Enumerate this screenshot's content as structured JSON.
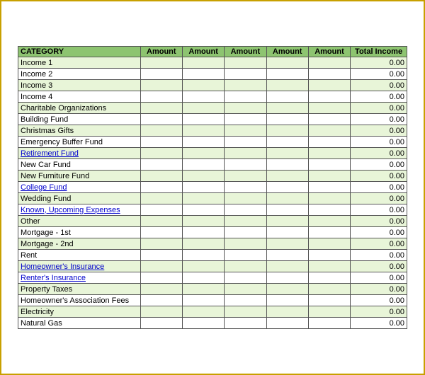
{
  "table": {
    "headers": {
      "category": "CATEGORY",
      "col1": "Amount",
      "col2": "Amount",
      "col3": "Amount",
      "col4": "Amount",
      "col5": "Amount",
      "total": "Total Income"
    },
    "rows": [
      {
        "label": "Income 1",
        "link": false,
        "total": "0.00",
        "shaded": true
      },
      {
        "label": "Income 2",
        "link": false,
        "total": "0.00",
        "shaded": false
      },
      {
        "label": "Income 3",
        "link": false,
        "total": "0.00",
        "shaded": true
      },
      {
        "label": "Income 4",
        "link": false,
        "total": "0.00",
        "shaded": false
      },
      {
        "label": "Charitable Organizations",
        "link": false,
        "total": "0.00",
        "shaded": true
      },
      {
        "label": "Building Fund",
        "link": false,
        "total": "0.00",
        "shaded": false
      },
      {
        "label": "Christmas Gifts",
        "link": false,
        "total": "0.00",
        "shaded": true
      },
      {
        "label": "Emergency Buffer Fund",
        "link": false,
        "total": "0.00",
        "shaded": false
      },
      {
        "label": "Retirement Fund",
        "link": true,
        "total": "0.00",
        "shaded": true
      },
      {
        "label": "New Car Fund",
        "link": false,
        "total": "0.00",
        "shaded": false
      },
      {
        "label": "New Furniture Fund",
        "link": false,
        "total": "0.00",
        "shaded": true
      },
      {
        "label": "College Fund",
        "link": true,
        "total": "0.00",
        "shaded": false
      },
      {
        "label": "Wedding Fund",
        "link": false,
        "total": "0.00",
        "shaded": true
      },
      {
        "label": "Known, Upcoming Expenses",
        "link": true,
        "total": "0.00",
        "shaded": false
      },
      {
        "label": "Other",
        "link": false,
        "total": "0.00",
        "shaded": true
      },
      {
        "label": "Mortgage - 1st",
        "link": false,
        "total": "0.00",
        "shaded": false
      },
      {
        "label": "Mortgage - 2nd",
        "link": false,
        "total": "0.00",
        "shaded": true
      },
      {
        "label": "Rent",
        "link": false,
        "total": "0.00",
        "shaded": false
      },
      {
        "label": "Homeowner's Insurance",
        "link": true,
        "total": "0.00",
        "shaded": true
      },
      {
        "label": "Renter's Insurance",
        "link": true,
        "total": "0.00",
        "shaded": false
      },
      {
        "label": "Property Taxes",
        "link": false,
        "total": "0.00",
        "shaded": true
      },
      {
        "label": "Homeowner's Association Fees",
        "link": false,
        "total": "0.00",
        "shaded": false
      },
      {
        "label": "Electricity",
        "link": false,
        "total": "0.00",
        "shaded": true
      },
      {
        "label": "Natural Gas",
        "link": false,
        "total": "0.00",
        "shaded": false
      }
    ]
  }
}
